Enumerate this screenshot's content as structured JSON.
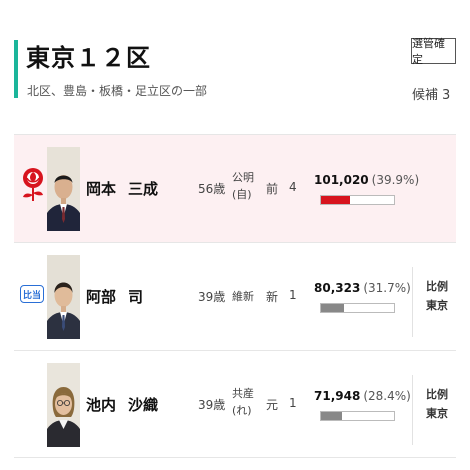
{
  "header": {
    "title": "東京１２区",
    "area": "北区、豊島・板橋・足立区の一部",
    "status_button": "選管確定",
    "candidates_label": "候補",
    "candidates_count": "3"
  },
  "colors": {
    "accent": "#1bb59a",
    "winner_bg": "#fdf0f2",
    "winner_bar": "#d7141e",
    "other_bar": "#888888",
    "proportional_badge": "#2a6fd6"
  },
  "candidates": [
    {
      "surname": "岡本",
      "given": "三成",
      "age": "56歳",
      "party": [
        "公明",
        "(自)"
      ],
      "status": "前",
      "wins": "4",
      "votes": "101,020",
      "pct": "(39.9%)",
      "share": 0.399,
      "elected_icon": "rose-icon",
      "winner": true
    },
    {
      "surname": "阿部",
      "given": "司",
      "age": "39歳",
      "party": [
        "維新"
      ],
      "status": "新",
      "wins": "1",
      "votes": "80,323",
      "pct": "(31.7%)",
      "share": 0.317,
      "badge": "比当",
      "proportional": [
        "比例",
        "東京"
      ]
    },
    {
      "surname": "池内",
      "given": "沙織",
      "age": "39歳",
      "party": [
        "共産",
        "(れ)"
      ],
      "status": "元",
      "wins": "1",
      "votes": "71,948",
      "pct": "(28.4%)",
      "share": 0.284,
      "proportional": [
        "比例",
        "東京"
      ]
    }
  ]
}
